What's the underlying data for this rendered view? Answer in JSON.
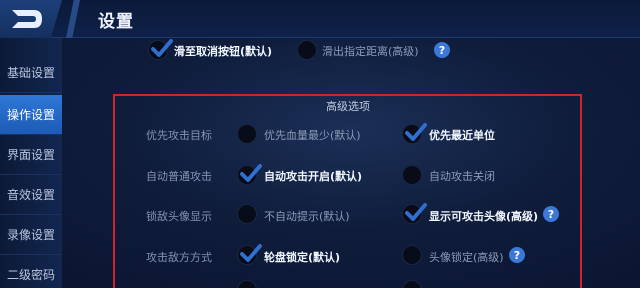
{
  "header": {
    "title": "设置"
  },
  "sidebar": {
    "items": [
      {
        "label": "基础设置",
        "active": false
      },
      {
        "label": "操作设置",
        "active": true
      },
      {
        "label": "界面设置",
        "active": false
      },
      {
        "label": "音效设置",
        "active": false
      },
      {
        "label": "录像设置",
        "active": false
      },
      {
        "label": "二级密码",
        "active": false
      }
    ]
  },
  "top_options": {
    "slide_cancel": {
      "label": "滑至取消按钮(默认)",
      "checked": true
    },
    "slide_distance": {
      "label": "滑出指定距离(高级)",
      "checked": false
    },
    "help": "?"
  },
  "advanced": {
    "title": "高级选项",
    "rows": [
      {
        "label": "优先攻击目标",
        "opt1": {
          "label": "优先血量最少(默认)",
          "checked": false
        },
        "opt2": {
          "label": "优先最近单位",
          "checked": true
        }
      },
      {
        "label": "自动普通攻击",
        "opt1": {
          "label": "自动攻击开启(默认)",
          "checked": true
        },
        "opt2": {
          "label": "自动攻击关闭",
          "checked": false
        }
      },
      {
        "label": "锁敌头像显示",
        "opt1": {
          "label": "不自动提示(默认)",
          "checked": false
        },
        "opt2": {
          "label": "显示可攻击头像(高级)",
          "checked": true
        },
        "help": "?"
      },
      {
        "label": "攻击敌方方式",
        "opt1": {
          "label": "轮盘锁定(默认)",
          "checked": true
        },
        "opt2": {
          "label": "头像锁定(高级)",
          "checked": false
        },
        "help": "?"
      }
    ]
  },
  "colors": {
    "accent": "#2f77d6",
    "highlight_border": "#d1242a",
    "check": "#2f6fd0"
  }
}
